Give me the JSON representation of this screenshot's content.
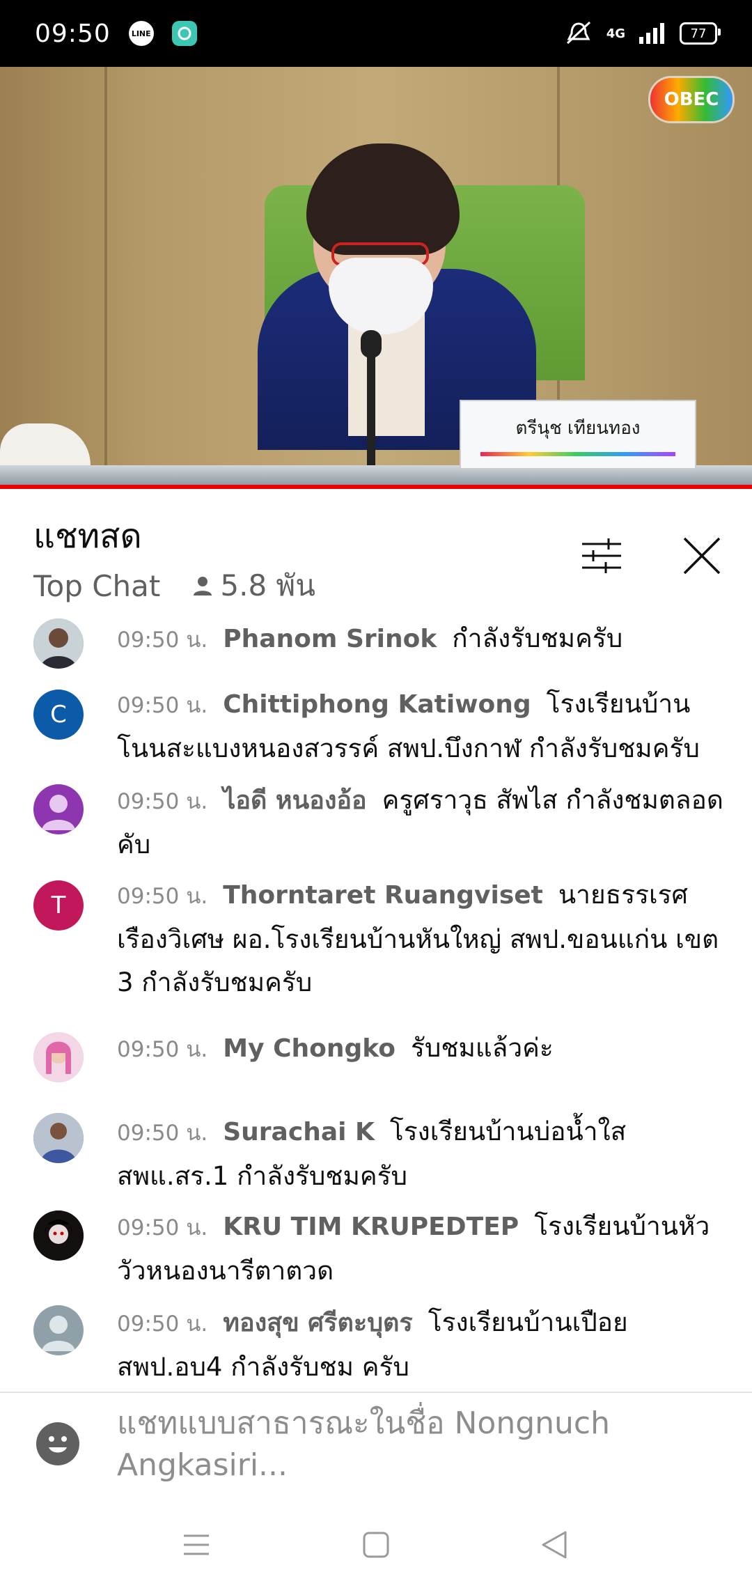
{
  "status_bar": {
    "time": "09:50",
    "app_icons": [
      "line-app-icon",
      "chat-bubble-app-icon"
    ],
    "line_label": "LINE",
    "network": "4G",
    "battery": "77"
  },
  "video": {
    "channel_logo": "OBEC",
    "nameplate_name": "ตรีนุช เทียนทอง",
    "progress_color": "#e00000"
  },
  "chat_header": {
    "title": "แชทสด",
    "mode": "Top Chat",
    "viewers": "5.8 พัน",
    "icons": [
      "filter-sliders-icon",
      "close-icon"
    ]
  },
  "messages": [
    {
      "time": "09:50 น.",
      "author": "Phanom Srinok",
      "text": "กำลังรับชมครับ",
      "avatar_letter": "",
      "avatar_color": "#7d8a97"
    },
    {
      "time": "09:50 น.",
      "author": "Chittiphong Katiwong",
      "text": "โรงเรียนบ้านโนนสะแบงหนองสวรรค์ สพป.บึงกาฬ กำลังรับชมครับ",
      "avatar_letter": "C",
      "avatar_color": "#0b5ba8"
    },
    {
      "time": "09:50 น.",
      "author": "ไอดี หนองอ้อ",
      "text": "ครูศราวุธ สัพไส กำลังชมตลอดคับ",
      "avatar_letter": "",
      "avatar_color": "#8e35b0"
    },
    {
      "time": "09:50 น.",
      "author": "Thorntaret Ruangviset",
      "text": "นายธรรเรศ เรืองวิเศษ ผอ.โรงเรียนบ้านหันใหญ่ สพป.ขอนแก่น เขต 3 กำลังรับชมครับ",
      "avatar_letter": "T",
      "avatar_color": "#c2185b"
    },
    {
      "time": "09:50 น.",
      "author": "My Chongko",
      "text": "รับชมแล้วค่ะ",
      "avatar_letter": "",
      "avatar_color": "#e8a8d0"
    },
    {
      "time": "09:50 น.",
      "author": "Surachai K",
      "text": "โรงเรียนบ้านบ่อน้ำใส สพแ.สร.1 กำลังรับชมครับ",
      "avatar_letter": "",
      "avatar_color": "#5a6f8e"
    },
    {
      "time": "09:50 น.",
      "author": "KRU TIM KRUPEDTEP",
      "text": "โรงเรียนบ้านหัววัวหนองนารีตาตวด",
      "avatar_letter": "",
      "avatar_color": "#2a1a1a"
    },
    {
      "time": "09:50 น.",
      "author": "ทองสุข ศรีตะบุตร",
      "text": "โรงเรียนบ้านเปือย สพป.อบ4 กำลังรับชม ครับ",
      "avatar_letter": "",
      "avatar_color": "#8fa0a8"
    }
  ],
  "input": {
    "placeholder": "แชทแบบสาธารณะในชื่อ Nongnuch Angkasiri...",
    "icon": "emoji-face-icon"
  },
  "nav_bar": {
    "icons": [
      "menu-icon",
      "home-square-icon",
      "back-triangle-icon"
    ]
  }
}
